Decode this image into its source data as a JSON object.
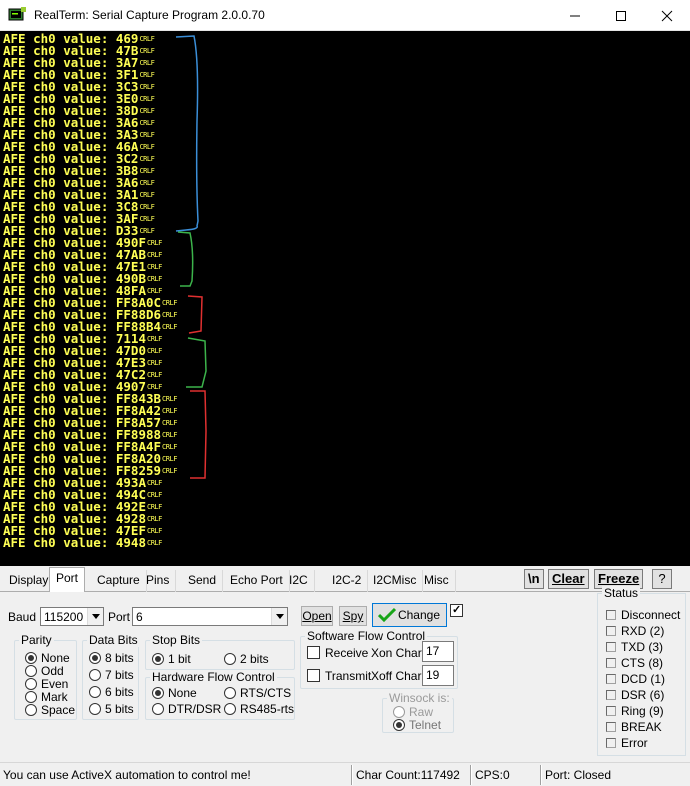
{
  "window": {
    "title": "RealTerm: Serial Capture Program 2.0.0.70",
    "icon": "realterm-app-icon"
  },
  "terminal": {
    "line_prefix": "AFE ch0 value: ",
    "line_ending": "CRLF",
    "text_color": "#ffff55",
    "background": "#000000",
    "values": [
      "469",
      "47B",
      "3A7",
      "3F1",
      "3C3",
      "3E0",
      "38D",
      "3A6",
      "3A3",
      "46A",
      "3C2",
      "3B8",
      "3A6",
      "3A1",
      "3C8",
      "3AF",
      "D33",
      "490F",
      "47AB",
      "47E1",
      "490B",
      "48FA",
      "FF8A0C",
      "FF88D6",
      "FF88B4",
      "7114",
      "47D0",
      "47E3",
      "47C2",
      "4907",
      "FF843B",
      "FF8A42",
      "FF8A57",
      "FF8988",
      "FF8A4F",
      "FF8A20",
      "FF8259",
      "493A",
      "494C",
      "492E",
      "4928",
      "47EF",
      "4948"
    ],
    "bracket_colors": {
      "blue": "#3b8fd9",
      "green": "#3cb44b",
      "red": "#e03030"
    }
  },
  "tabs": [
    "Display",
    "Port",
    "Capture",
    "Pins",
    "Send",
    "Echo Port",
    "I2C",
    "I2C-2",
    "I2CMisc",
    "Misc"
  ],
  "active_tab": "Port",
  "toolbar": {
    "newline_label": "\\n",
    "clear_label": "Clear",
    "freeze_label": "Freeze",
    "help_label": "?"
  },
  "port": {
    "baud_label": "Baud",
    "baud_value": "115200",
    "port_label": "Port",
    "port_value": "6",
    "open_label": "Open",
    "spy_label": "Spy",
    "change_label": "Change",
    "change_checked": true,
    "parity": {
      "title": "Parity",
      "options": [
        "None",
        "Odd",
        "Even",
        "Mark",
        "Space"
      ],
      "selected": "None"
    },
    "databits": {
      "title": "Data Bits",
      "options": [
        "8 bits",
        "7 bits",
        "6 bits",
        "5 bits"
      ],
      "selected": "8 bits"
    },
    "stopbits": {
      "title": "Stop Bits",
      "options": [
        "1 bit",
        "2 bits"
      ],
      "selected": "1 bit"
    },
    "hwflow": {
      "title": "Hardware Flow Control",
      "options": [
        "None",
        "RTS/CTS",
        "DTR/DSR",
        "RS485-rts"
      ],
      "selected": "None"
    },
    "swflow": {
      "title": "Software Flow Control",
      "receive_label": "Receive",
      "transmit_label": "Transmit",
      "xon_label": "Xon Char:",
      "xon_value": "17",
      "xoff_label": "Xoff Char:",
      "xoff_value": "19"
    },
    "winsock": {
      "title": "Winsock is:",
      "options": [
        "Raw",
        "Telnet"
      ],
      "selected": "Telnet"
    }
  },
  "status": {
    "title": "Status",
    "items": [
      "Disconnect",
      "RXD (2)",
      "TXD (3)",
      "CTS (8)",
      "DCD (1)",
      "DSR (6)",
      "Ring (9)",
      "BREAK",
      "Error"
    ]
  },
  "statusbar": {
    "message": "You can use ActiveX automation to control me!",
    "char_count": "Char Count:117492",
    "cps": "CPS:0",
    "port_state": "Port: Closed"
  }
}
